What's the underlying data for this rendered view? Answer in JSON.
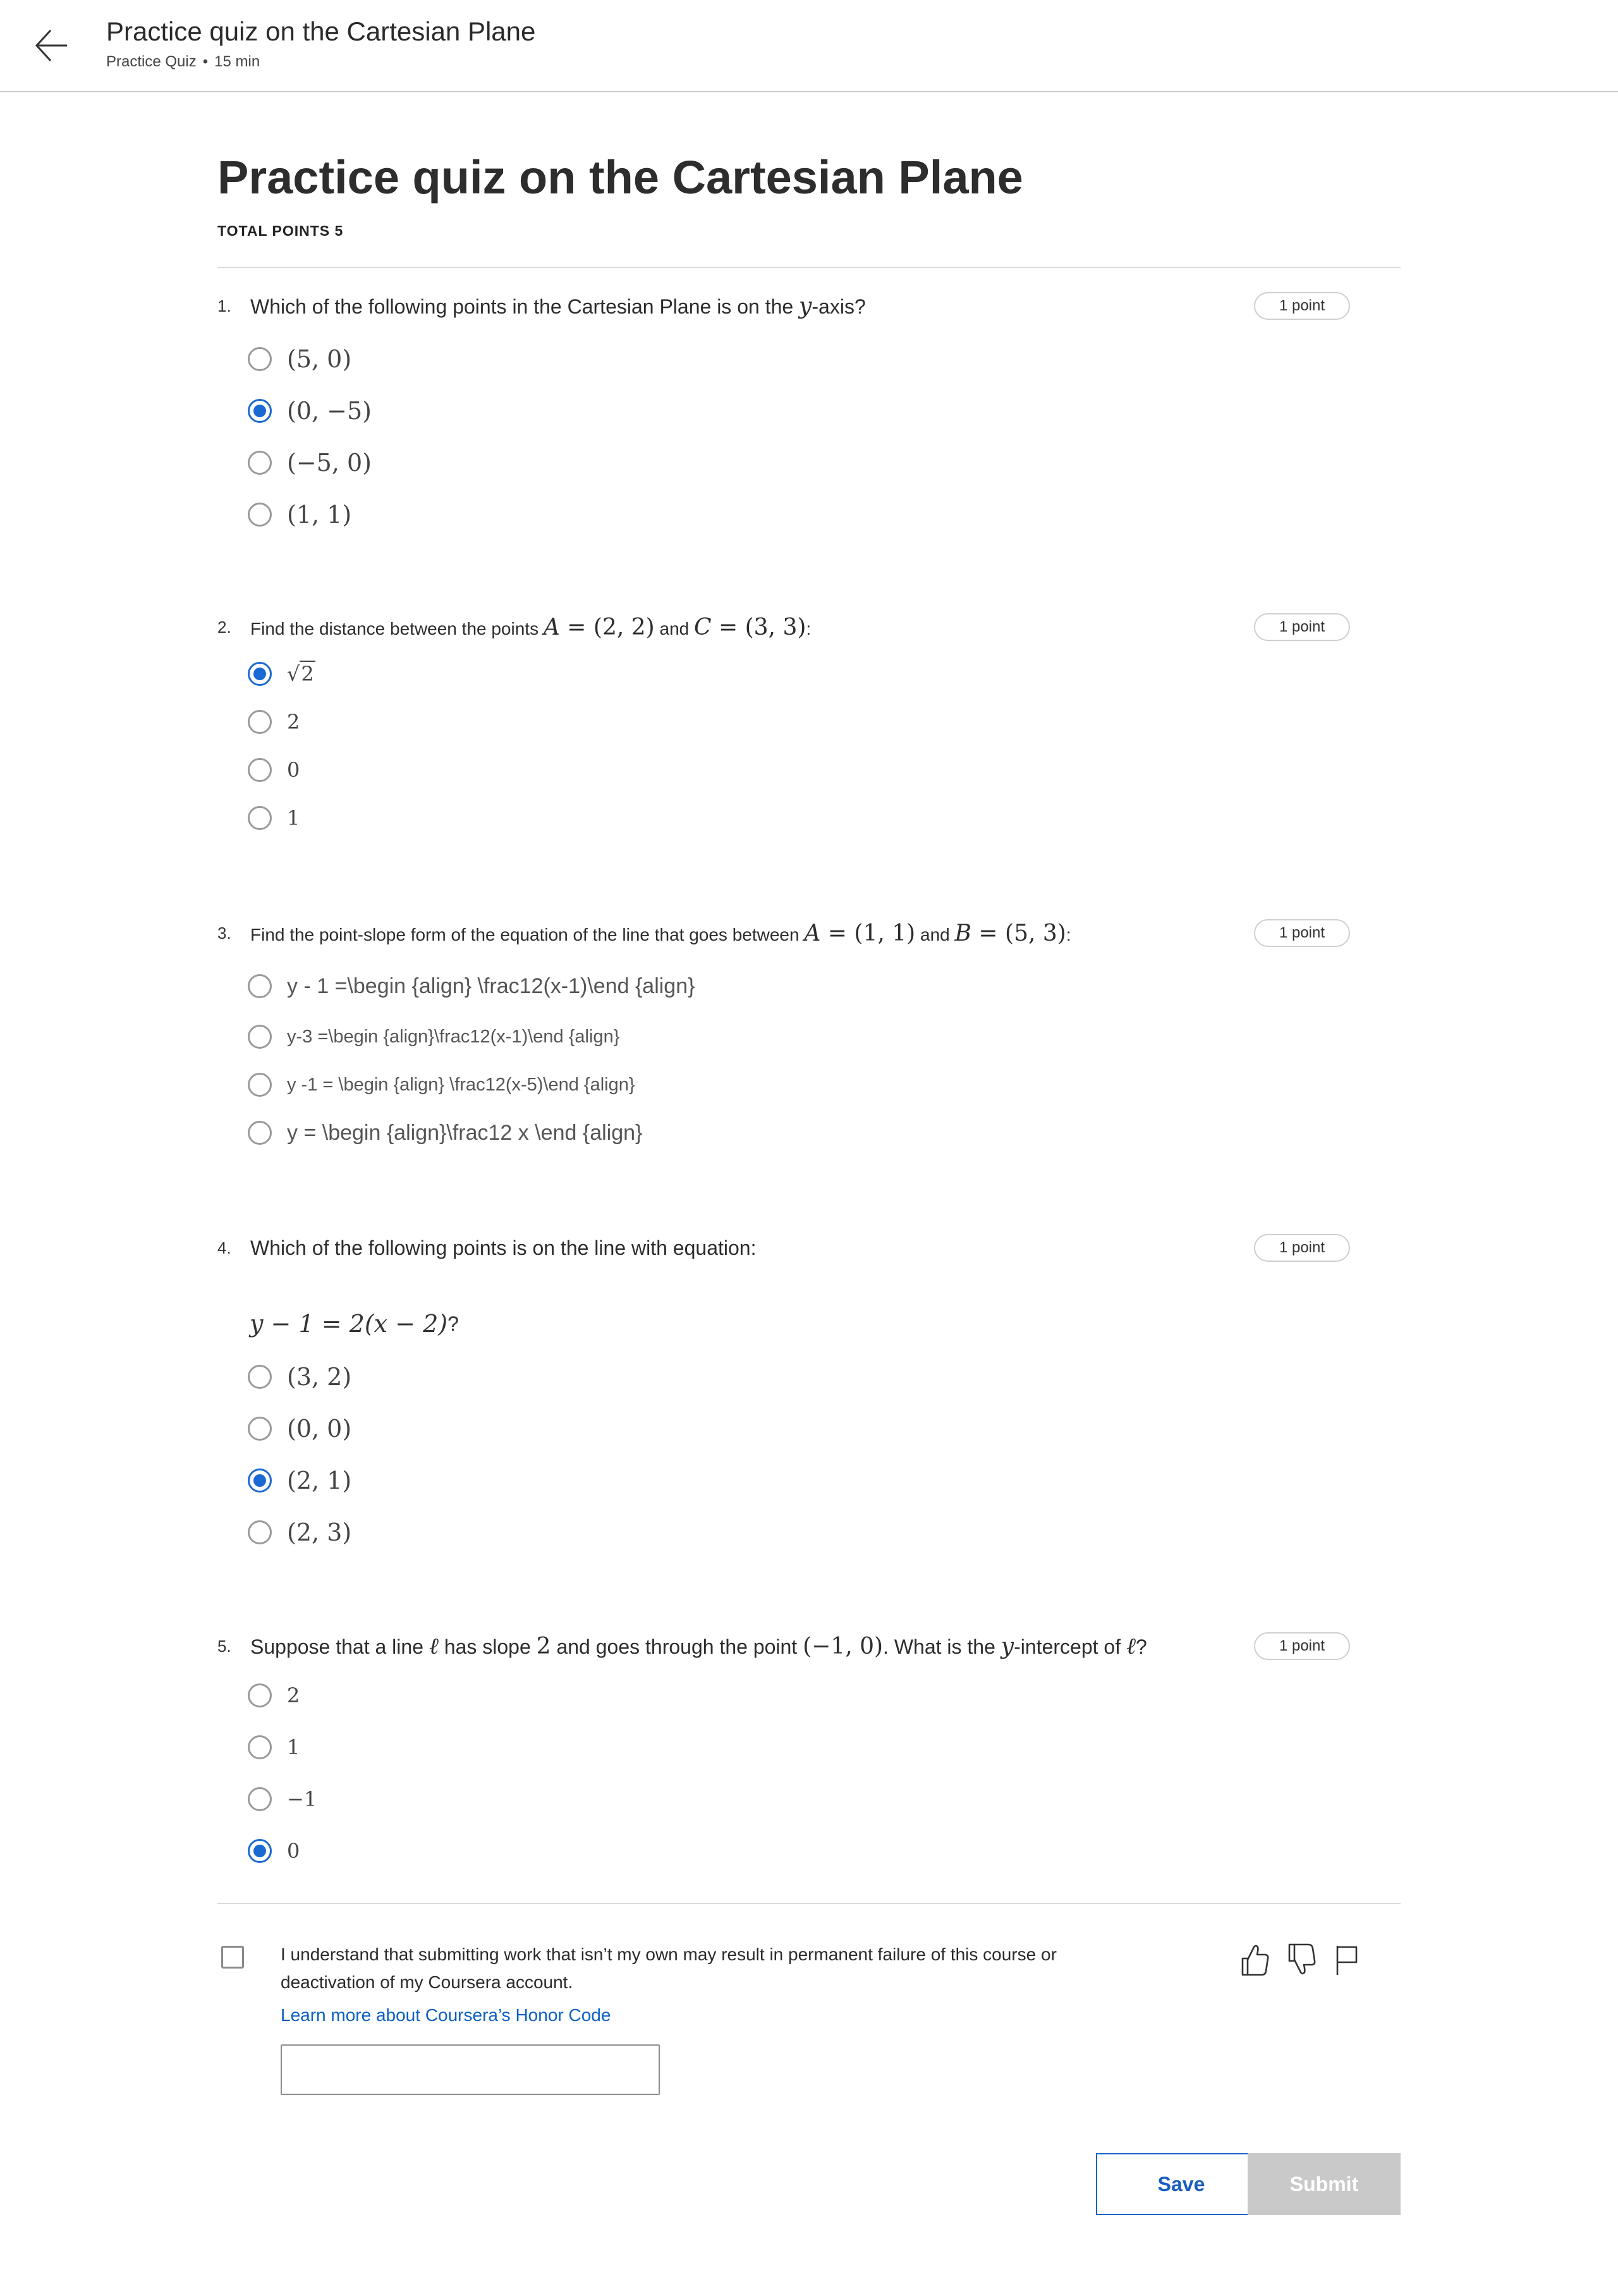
{
  "header": {
    "title": "Practice quiz on the Cartesian Plane",
    "type": "Practice Quiz",
    "separator": "•",
    "duration": "15 min"
  },
  "page": {
    "title": "Practice quiz on the Cartesian Plane",
    "total_points": "TOTAL POINTS 5"
  },
  "questions": [
    {
      "number": "1.",
      "text_parts": [
        "Which of the following points in the Cartesian Plane is on the ",
        "y",
        "-axis?"
      ],
      "points": "1 point",
      "options": [
        {
          "label": "(5, 0)",
          "selected": false
        },
        {
          "label": "(0, −5)",
          "selected": true
        },
        {
          "label": "(−5, 0)",
          "selected": false
        },
        {
          "label": "(1, 1)",
          "selected": false
        }
      ]
    },
    {
      "number": "2.",
      "text_parts": [
        "Find the distance between the points ",
        "A",
        " = ",
        "(2, 2)",
        " and ",
        "C",
        " = ",
        "(3, 3)",
        ":"
      ],
      "points": "1 point",
      "options": [
        {
          "label": "√2",
          "radicand": "2",
          "selected": true
        },
        {
          "label": "2",
          "selected": false
        },
        {
          "label": "0",
          "selected": false
        },
        {
          "label": "1",
          "selected": false
        }
      ]
    },
    {
      "number": "3.",
      "text_parts": [
        "Find the point-slope form of the equation of the line that goes between ",
        "A",
        " = ",
        "(1, 1)",
        " and ",
        "B",
        " = ",
        "(5, 3)",
        ":"
      ],
      "points": "1 point",
      "options": [
        {
          "label": "y - 1 =\\begin {align} \\frac12(x-1)\\end {align}",
          "selected": false
        },
        {
          "label": "y-3 =\\begin {align}\\frac12(x-1)\\end {align}",
          "selected": false
        },
        {
          "label": "y -1 = \\begin {align} \\frac12(x-5)\\end {align}",
          "selected": false
        },
        {
          "label": "y = \\begin {align}\\frac12 x \\end {align}",
          "selected": false
        }
      ]
    },
    {
      "number": "4.",
      "text": "Which of the following points is on the line with equation:",
      "equation": "y − 1 = 2(x − 2)",
      "equation_suffix": "?",
      "points": "1 point",
      "options": [
        {
          "label": "(3, 2)",
          "selected": false
        },
        {
          "label": "(0, 0)",
          "selected": false
        },
        {
          "label": "(2, 1)",
          "selected": true
        },
        {
          "label": "(2, 3)",
          "selected": false
        }
      ]
    },
    {
      "number": "5.",
      "text_parts": [
        "Suppose that a line ",
        "ℓ",
        " has slope ",
        "2",
        " and goes through the point ",
        "(−1, 0)",
        ". What is the ",
        "y",
        "-intercept of ",
        "ℓ",
        "?"
      ],
      "points": "1 point",
      "options": [
        {
          "label": "2",
          "selected": false
        },
        {
          "label": "1",
          "selected": false
        },
        {
          "label": "−1",
          "selected": false
        },
        {
          "label": "0",
          "selected": true
        }
      ]
    }
  ],
  "honor": {
    "checked": false,
    "text": "I understand that submitting work that isn’t my own may result in permanent failure of this course or deactivation of my Coursera account.",
    "link": "Learn more about Coursera’s Honor Code",
    "input_value": ""
  },
  "feedback_icons": [
    "thumbs-up-icon",
    "thumbs-down-icon",
    "flag-icon"
  ],
  "buttons": {
    "save": "Save",
    "submit": "Submit"
  },
  "colors": {
    "accent": "#1a6ad3",
    "link": "#0b5fc4",
    "submit_disabled": "#c9c9c9"
  }
}
